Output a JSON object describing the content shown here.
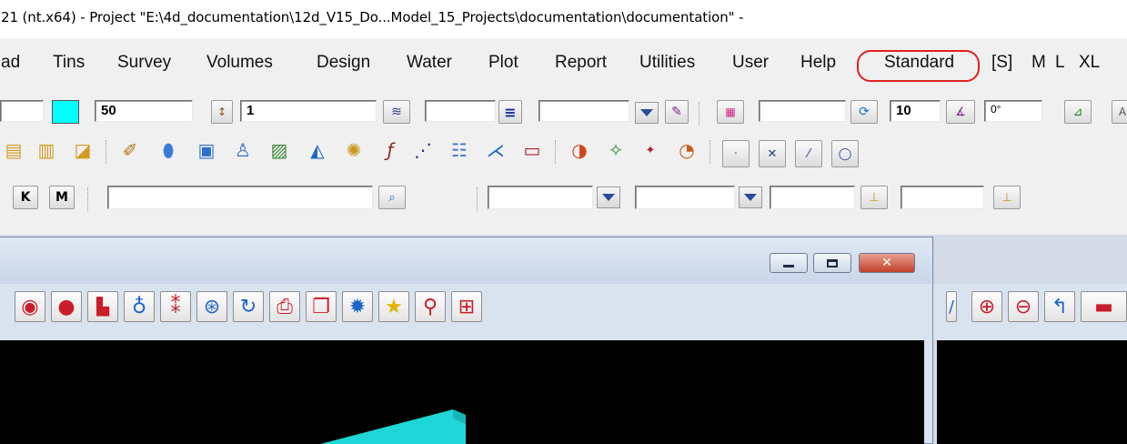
{
  "window": {
    "title": "21 (nt.x64) - Project \"E:\\4d_documentation\\12d_V15_Do...Model_15_Projects\\documentation\\documentation\" -"
  },
  "menu": {
    "items": [
      "ad",
      "Tins",
      "Survey",
      "Volumes",
      "Design",
      "Water",
      "Plot",
      "Report",
      "Utilities",
      "User",
      "Help",
      "Standard",
      "[S]",
      "M",
      "L",
      "XL"
    ],
    "highlighted": "Standard"
  },
  "toolbar1": {
    "size_value": "50",
    "text_height_value": "1",
    "line_width_value": "10",
    "angle_value": "0°"
  },
  "toolbar3": {
    "k_button": "K",
    "m_button": "M",
    "search_value": ""
  },
  "colors": {
    "swatch": "#00ffff",
    "accent": "#e02020",
    "viewport_bg": "#000000",
    "model_color": "#1fd6d6"
  },
  "child_toolbar": {
    "icons": [
      "eye-icon",
      "planet-icon",
      "bulldozer-icon",
      "joystick-icon",
      "footprints-icon",
      "steering-wheel-icon",
      "refresh-icon",
      "printer-icon",
      "copy-icon",
      "gear-icon",
      "star-icon",
      "pin-icon",
      "grid-icon"
    ]
  },
  "right_toolbar": {
    "icons": [
      "zoom-in-icon",
      "zoom-out-icon",
      "undo-icon",
      "minus-icon"
    ]
  }
}
